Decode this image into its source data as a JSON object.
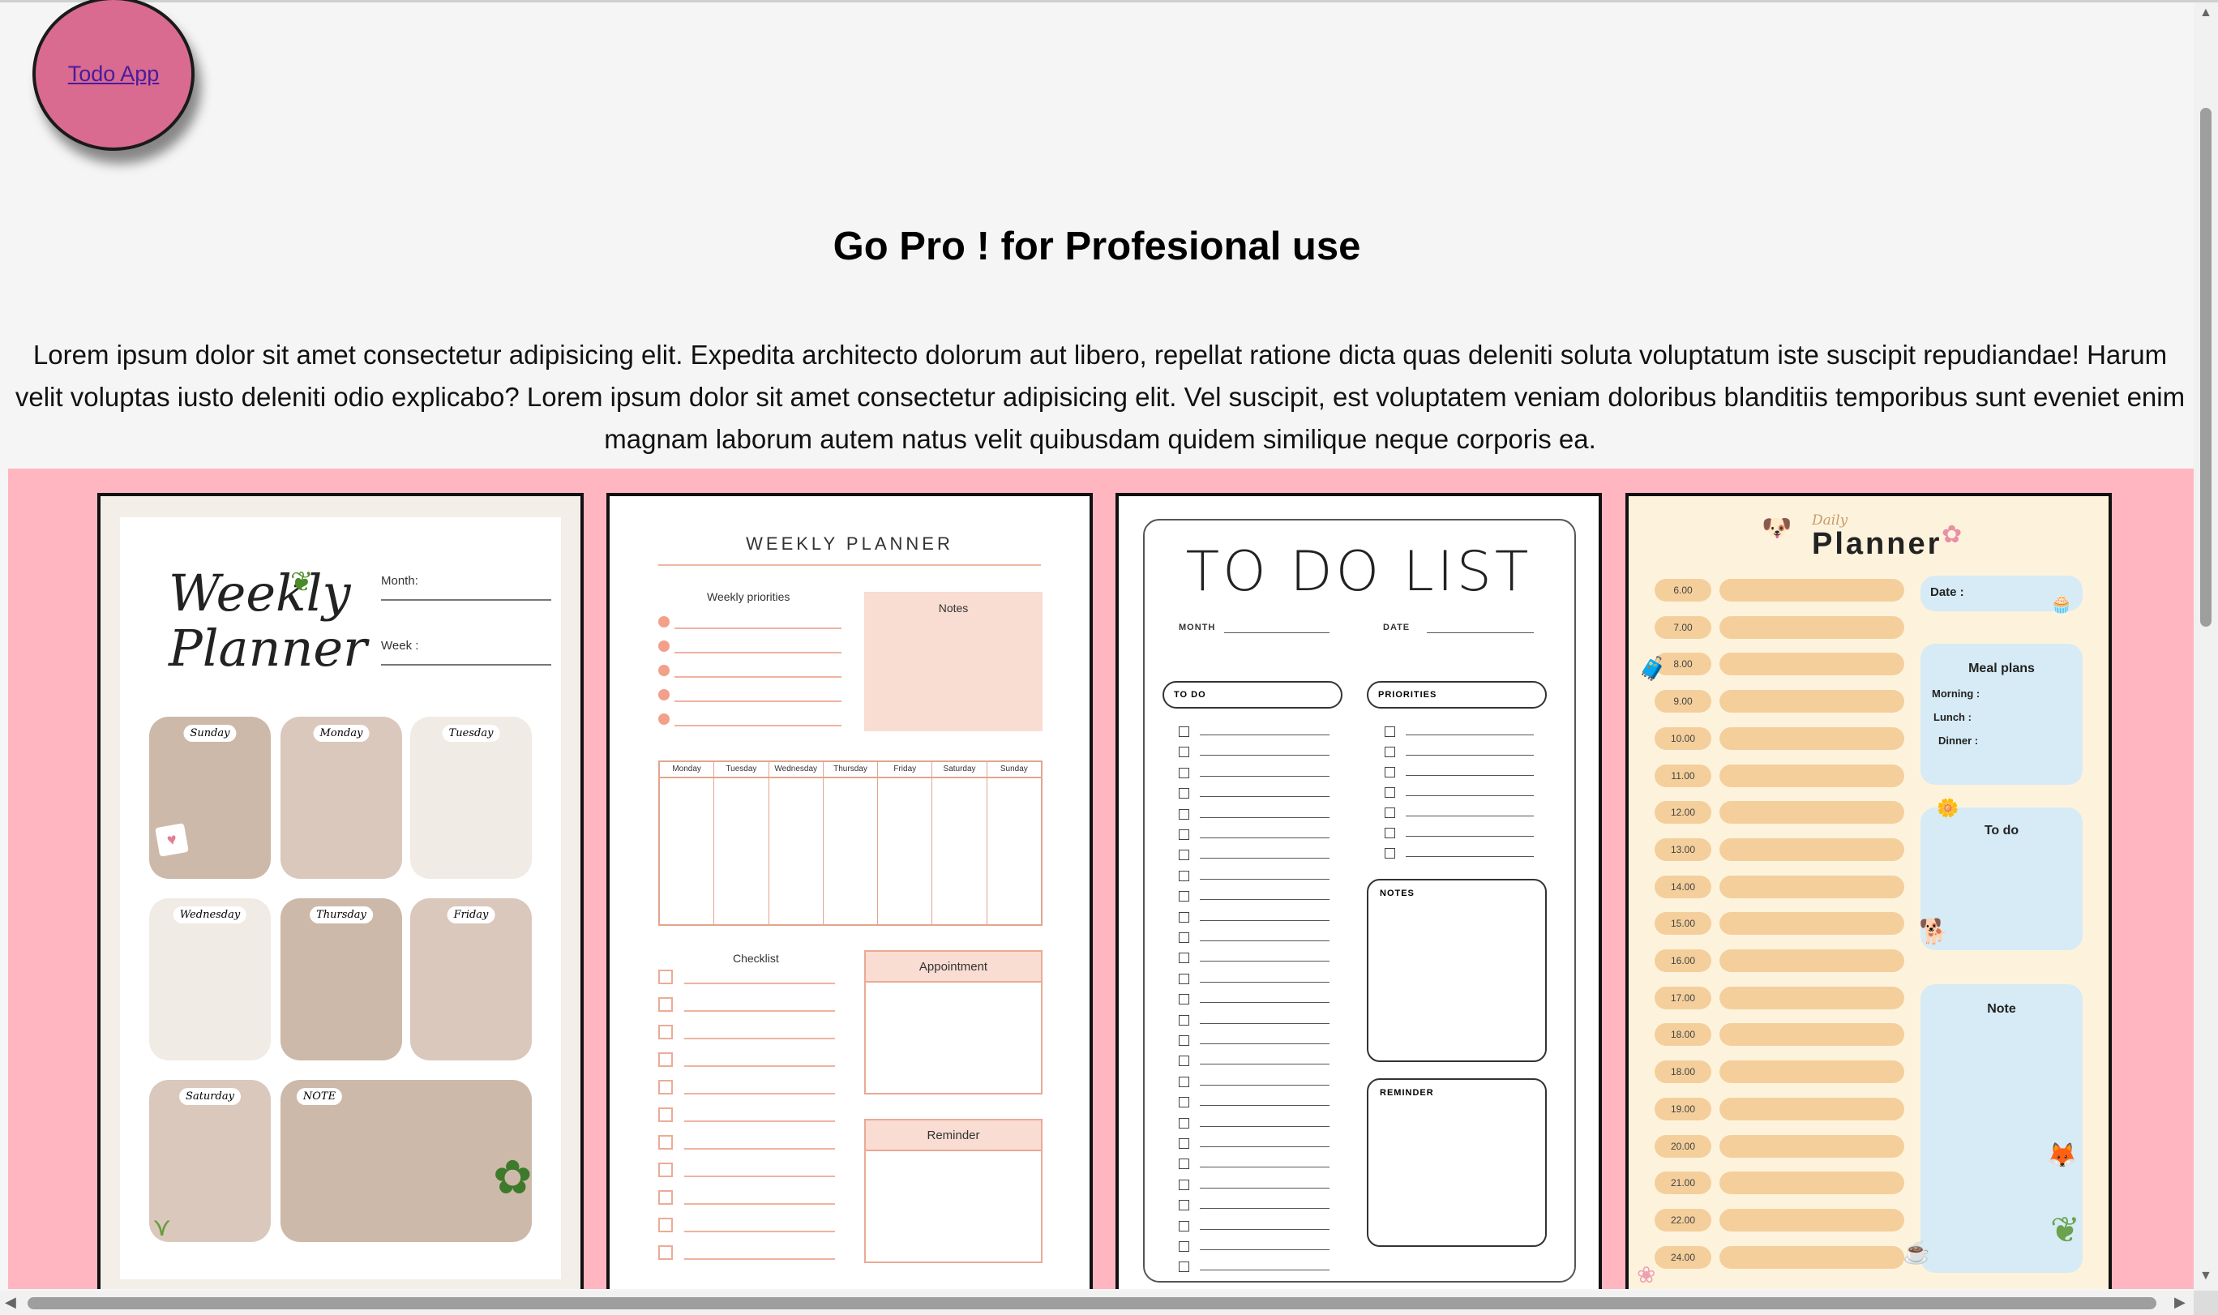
{
  "logo": {
    "label": "Todo App"
  },
  "hero": {
    "title": "Go Pro ! for Profesional use",
    "paragraph": "Lorem ipsum dolor sit amet consectetur adipisicing elit. Expedita architecto dolorum aut libero, repellat ratione dicta quas deleniti soluta voluptatum iste suscipit repudiandae! Harum velit voluptas iusto deleniti odio explicabo? Lorem ipsum dolor sit amet consectetur adipisicing elit. Vel suscipit, est voluptatem veniam doloribus blanditiis temporibus sunt eveniet enim magnam laborum autem natus velit quibusdam quidem similique neque corporis ea."
  },
  "colors": {
    "page_bg": "#f5f5f5",
    "gallery_bg": "#ffb6c1",
    "logo_bg": "#d96b91"
  },
  "templates": {
    "weekly_planner_1": {
      "title_line1": "Weekly",
      "title_line2": "Planner",
      "month_label": "Month:",
      "week_label": "Week :",
      "days": [
        "Sunday",
        "Monday",
        "Tuesday",
        "Wednesday",
        "Thursday",
        "Friday",
        "Saturday"
      ],
      "note_label": "NOTE"
    },
    "weekly_planner_2": {
      "title": "WEEKLY PLANNER",
      "priorities_label": "Weekly priorities",
      "notes_label": "Notes",
      "days": [
        "Monday",
        "Tuesday",
        "Wednesday",
        "Thursday",
        "Friday",
        "Saturday",
        "Sunday"
      ],
      "checklist_label": "Checklist",
      "appointment_label": "Appointment",
      "reminder_label": "Reminder"
    },
    "todo_list": {
      "title": "TO DO LIST",
      "month_label": "MONTH",
      "date_label": "DATE",
      "todo_label": "TO DO",
      "priorities_label": "PRIORITIES",
      "notes_label": "NOTES",
      "reminder_label": "REMINDER"
    },
    "daily_planner": {
      "subtitle": "Daily",
      "title": "Planner",
      "hours": [
        "6.00",
        "7.00",
        "8.00",
        "9.00",
        "10.00",
        "11.00",
        "12.00",
        "13.00",
        "14.00",
        "15.00",
        "16.00",
        "17.00",
        "18.00",
        "18.00",
        "19.00",
        "20.00",
        "21.00",
        "22.00",
        "24.00"
      ],
      "date_label": "Date :",
      "meal_label": "Meal plans",
      "morning_label": "Morning :",
      "lunch_label": "Lunch :",
      "dinner_label": "Dinner :",
      "todo_label": "To do",
      "note_label": "Note"
    }
  }
}
